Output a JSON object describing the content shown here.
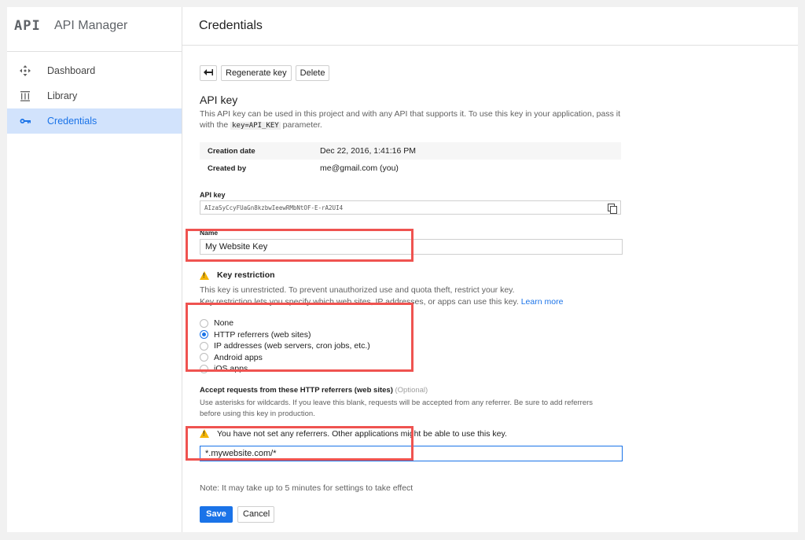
{
  "app": {
    "logo": "API",
    "title": "API Manager"
  },
  "sidebar": {
    "items": [
      {
        "label": "Dashboard",
        "icon": "dashboard-icon",
        "active": false
      },
      {
        "label": "Library",
        "icon": "library-icon",
        "active": false
      },
      {
        "label": "Credentials",
        "icon": "key-icon",
        "active": true
      }
    ]
  },
  "header": {
    "title": "Credentials"
  },
  "toolbar": {
    "back_label": "←",
    "regenerate_label": "Regenerate key",
    "delete_label": "Delete"
  },
  "apikey_section": {
    "heading": "API key",
    "desc_part1": "This API key can be used in this project and with any API that supports it. To use this key in your application, pass it with the ",
    "desc_code": "key=API_KEY",
    "desc_part2": " parameter."
  },
  "meta": {
    "creation_label": "Creation date",
    "creation_value": "Dec 22, 2016, 1:41:16 PM",
    "created_by_label": "Created by",
    "created_by_value": "me@gmail.com (you)"
  },
  "apikey_field": {
    "label": "API key",
    "value": "AIzaSyCcyFUaGn8kzbwIeewRMbNtOF-E-rA2UI4"
  },
  "name_field": {
    "label": "Name",
    "value": "My Website Key"
  },
  "key_restriction": {
    "heading": "Key restriction",
    "line1": "This key is unrestricted. To prevent unauthorized use and quota theft, restrict your key.",
    "line2": "Key restriction lets you specify which web sites, IP addresses, or apps can use this key. ",
    "learn_more": "Learn more",
    "options": [
      {
        "label": "None",
        "selected": false
      },
      {
        "label": "HTTP referrers (web sites)",
        "selected": true
      },
      {
        "label": "IP addresses (web servers, cron jobs, etc.)",
        "selected": false
      },
      {
        "label": "Android apps",
        "selected": false
      },
      {
        "label": "iOS apps",
        "selected": false
      }
    ]
  },
  "referrers": {
    "heading": "Accept requests from these HTTP referrers (web sites)",
    "optional": " (Optional)",
    "help1": "Use asterisks for wildcards. If you leave this blank, requests will be accepted from any referrer. Be sure to add referrers",
    "help2": "before using this key in production.",
    "warning": "You have not set any referrers. Other applications might be able to use this key.",
    "value": "*.mywebsite.com/*"
  },
  "note": "Note: It may take up to 5 minutes for settings to take effect",
  "actions": {
    "save_label": "Save",
    "cancel_label": "Cancel"
  },
  "colors": {
    "accent": "#1a73e8",
    "highlight": "#ef5350",
    "warning": "#f4b400"
  }
}
